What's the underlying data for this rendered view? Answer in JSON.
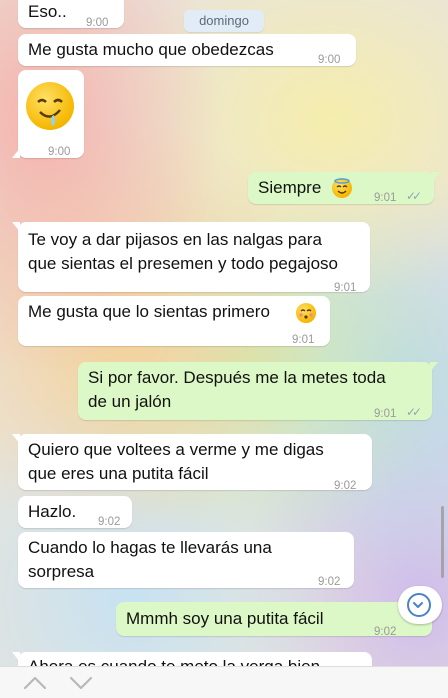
{
  "chat": {
    "date_badge": "domingo",
    "messages": [
      {
        "dir": "in",
        "text": "Eso..",
        "time": "9:00"
      },
      {
        "dir": "in",
        "text": "Me gusta mucho que obedezcas",
        "time": "9:00"
      },
      {
        "dir": "in",
        "emoji": "drooling-face-emoji",
        "time": "9:00"
      },
      {
        "dir": "out",
        "text": "Siempre",
        "emoji": "smiling-face-with-halo-emoji",
        "time": "9:01",
        "status": "read"
      },
      {
        "dir": "in",
        "text": "Te voy a dar pijasos en las nalgas para\nque sientas el presemen y todo pegajoso",
        "time": "9:01"
      },
      {
        "dir": "in",
        "text": "Me gusta que lo sientas primero",
        "emoji": "kissing-face-closed-eyes-emoji",
        "time": "9:01"
      },
      {
        "dir": "out",
        "text": "Si por favor. Después me la metes toda\nde un jalón",
        "time": "9:01",
        "status": "read"
      },
      {
        "dir": "in",
        "text": "Quiero que voltees a verme y me digas\nque eres una putita fácil",
        "time": "9:02"
      },
      {
        "dir": "in",
        "text": "Hazlo.",
        "time": "9:02"
      },
      {
        "dir": "in",
        "text": "Cuando lo hagas te llevarás una\nsorpresa",
        "time": "9:02"
      },
      {
        "dir": "out",
        "text": "Mmmh soy una putita fácil",
        "time": "9:02",
        "status": "read"
      },
      {
        "dir": "in",
        "text": "Ahora es cuando te meto la verga bien"
      }
    ]
  },
  "controls": {
    "scroll_down_icon": "chevron-down-circle-icon",
    "prev_icon": "chevron-up-icon",
    "next_icon": "chevron-down-icon"
  },
  "colors": {
    "incoming_bubble": "#ffffff",
    "outgoing_bubble": "#dcf8c6",
    "read_ticks": "#8fa8b6",
    "accent": "#4a82c8"
  }
}
